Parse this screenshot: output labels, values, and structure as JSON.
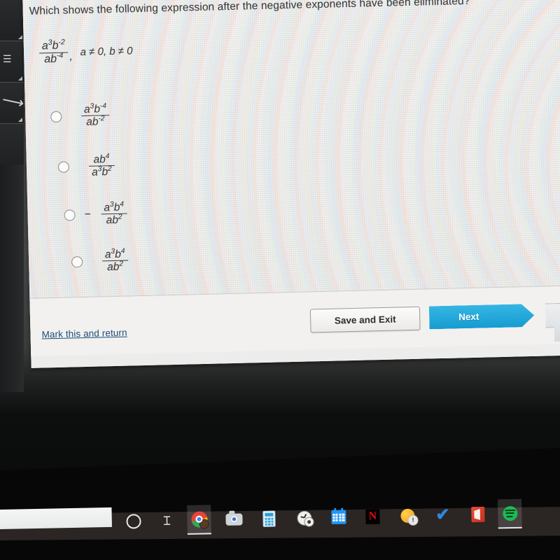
{
  "quiz": {
    "question": "Which shows the following expression after the negative exponents have been eliminated?",
    "stem": {
      "numerator_a": "a",
      "numerator_a_exp": "3",
      "numerator_b": "b",
      "numerator_b_exp": "-2",
      "denominator_a": "a",
      "denominator_b": "b",
      "denominator_b_exp": "-4",
      "condition": "a ≠ 0, b ≠ 0",
      "comma": ","
    },
    "options": [
      {
        "id": "option-1",
        "sign": "",
        "num_a": "a",
        "num_a_exp": "3",
        "num_b": "b",
        "num_b_exp": "-4",
        "den_a": "a",
        "den_a_exp": "",
        "den_b": "b",
        "den_b_exp": "-2",
        "selected": false
      },
      {
        "id": "option-2",
        "sign": "",
        "num_a": "a",
        "num_a_exp": "",
        "num_b": "b",
        "num_b_exp": "4",
        "den_a": "a",
        "den_a_exp": "3",
        "den_b": "b",
        "den_b_exp": "2",
        "selected": false
      },
      {
        "id": "option-3",
        "sign": "−",
        "num_a": "a",
        "num_a_exp": "3",
        "num_b": "b",
        "num_b_exp": "4",
        "den_a": "a",
        "den_a_exp": "",
        "den_b": "b",
        "den_b_exp": "2",
        "selected": false
      },
      {
        "id": "option-4",
        "sign": "",
        "num_a": "a",
        "num_a_exp": "3",
        "num_b": "b",
        "num_b_exp": "4",
        "den_a": "a",
        "den_a_exp": "",
        "den_b": "b",
        "den_b_exp": "2",
        "selected": false
      }
    ]
  },
  "footer": {
    "mark_link": "Mark this and return",
    "save_button": "Save and Exit",
    "next_button": "Next"
  },
  "taskbar": {
    "search_value": "",
    "items": [
      {
        "name": "cortana-icon",
        "label": "Cortana",
        "active": false
      },
      {
        "name": "task-view-icon",
        "label": "Task View",
        "active": false
      },
      {
        "name": "chrome-icon",
        "label": "Google Chrome",
        "active": true
      },
      {
        "name": "camera-icon",
        "label": "Camera",
        "active": false
      },
      {
        "name": "calculator-icon",
        "label": "Calculator",
        "active": false
      },
      {
        "name": "alarms-clock-icon",
        "label": "Alarms & Clock",
        "active": false
      },
      {
        "name": "calendar-icon",
        "label": "Calendar",
        "active": false
      },
      {
        "name": "netflix-icon",
        "label": "Netflix",
        "active": false
      },
      {
        "name": "weather-icon",
        "label": "Weather",
        "active": false
      },
      {
        "name": "todo-check-icon",
        "label": "To Do",
        "active": false
      },
      {
        "name": "office-icon",
        "label": "Office",
        "active": false
      },
      {
        "name": "spotify-icon",
        "label": "Spotify",
        "active": true
      }
    ],
    "task_view_glyph": "⌶",
    "netflix_glyph": "N",
    "weather_badge_glyph": "!",
    "check_glyph": "✔"
  },
  "colors": {
    "accent_blue": "#169cd0",
    "link_blue": "#1b4d7a",
    "page_bg": "#f1f0ef",
    "taskbar_bg": "#2b2523",
    "desk_gray": "#424443"
  },
  "left_toolbar": {
    "tools": [
      {
        "name": "tool-cell-top",
        "glyph": ""
      },
      {
        "name": "tool-cell-text",
        "glyph": "≡"
      },
      {
        "name": "tool-cell-cursor",
        "glyph": "↖"
      }
    ]
  }
}
